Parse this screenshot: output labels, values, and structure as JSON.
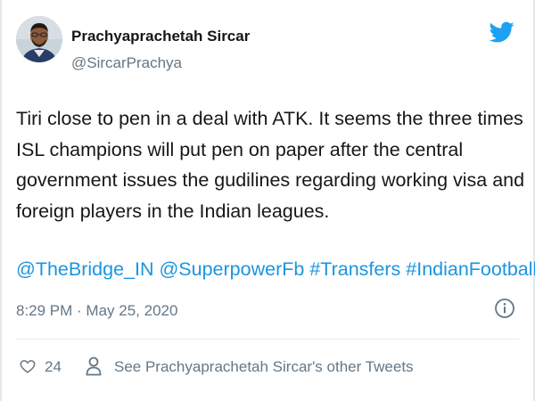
{
  "author": {
    "name": "Prachyaprachetah Sircar",
    "handle": "@SircarPrachya",
    "avatar_icon": "user-photo"
  },
  "brand": {
    "icon": "twitter-bird-icon",
    "color": "#1da1f2"
  },
  "tweet": {
    "lines": [
      "Tiri close to pen in a deal with ATK.  It seems the three times",
      "ISL champions will put pen on paper after the central",
      "government issues the gudilines regarding working visa and",
      "foreign players in the Indian leagues."
    ],
    "mentions": [
      "@TheBridge_IN",
      "@SuperpowerFb"
    ],
    "hashtags": [
      "#Transfers",
      "#IndianFootball"
    ],
    "link_color": "#1b95e0"
  },
  "meta": {
    "timestamp": "8:29 PM · May 25, 2020"
  },
  "footer": {
    "like_count": "24",
    "other_tweets_label": "See Prachyaprachetah Sircar's other Tweets"
  }
}
